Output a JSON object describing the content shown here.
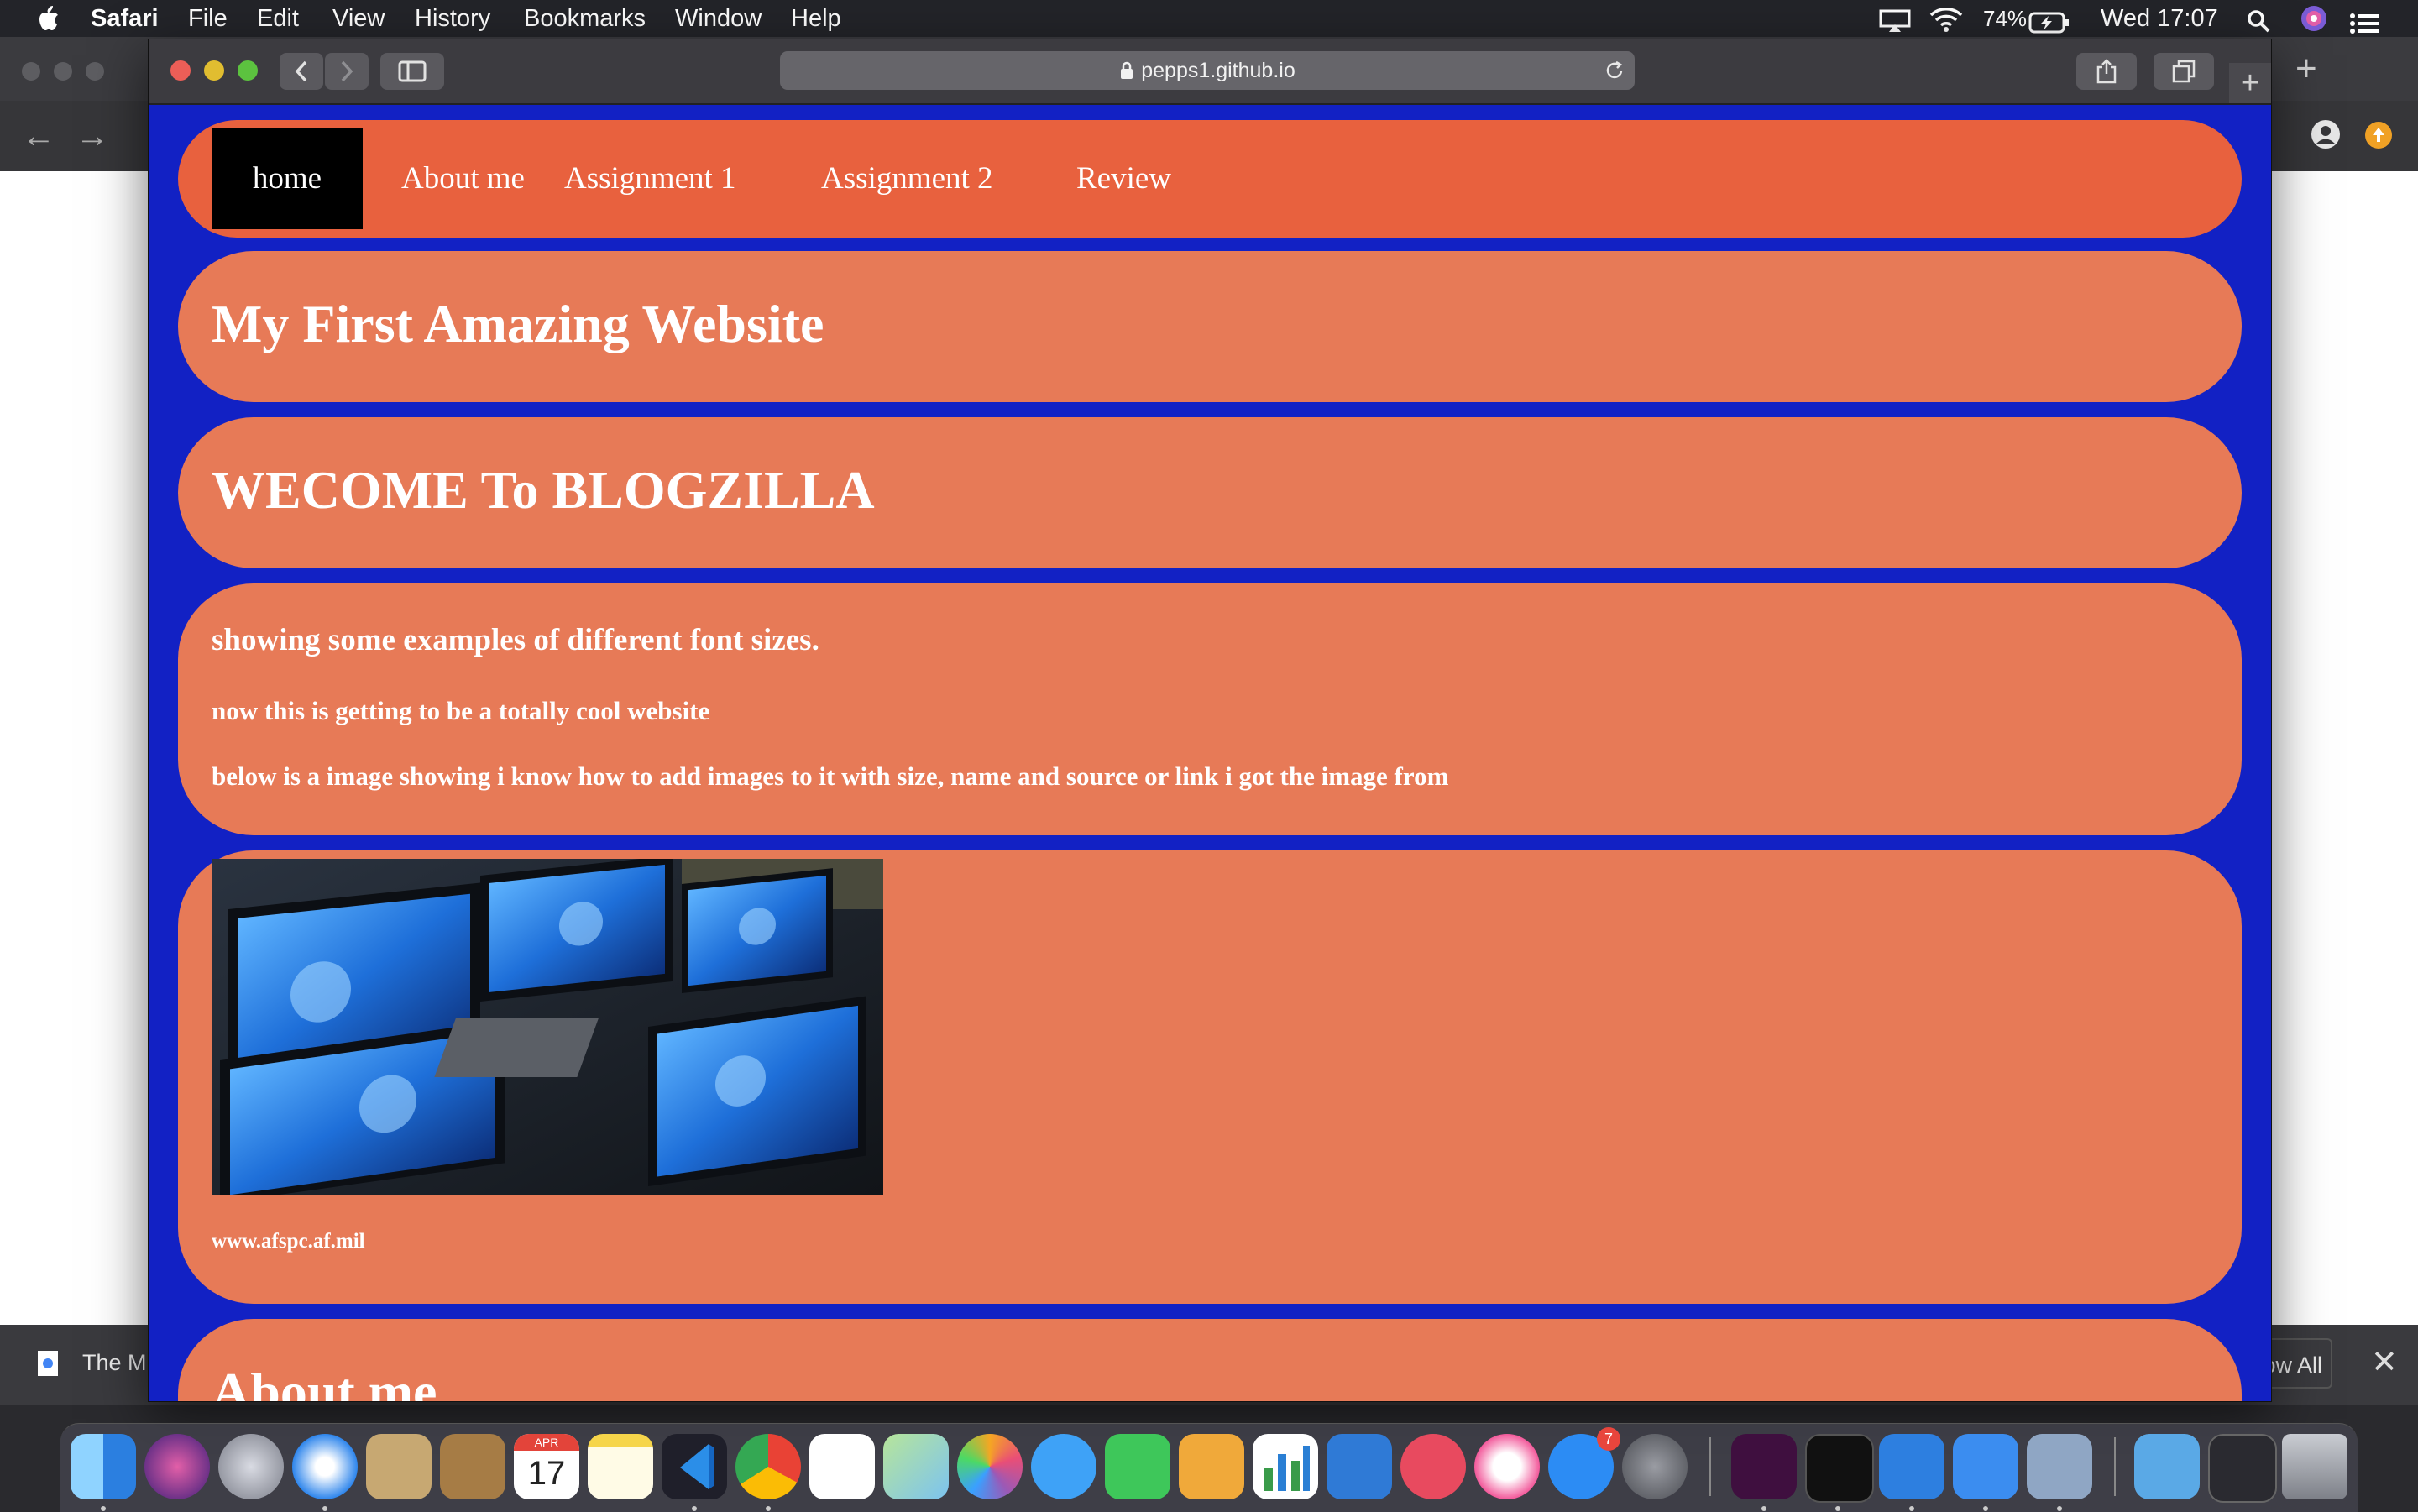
{
  "menubar": {
    "app": "Safari",
    "items": [
      "File",
      "Edit",
      "View",
      "History",
      "Bookmarks",
      "Window",
      "Help"
    ],
    "battery": "74%",
    "clock": "Wed 17:07"
  },
  "browser": {
    "url": "pepps1.github.io"
  },
  "background_window": {
    "download_text": "The M",
    "show_all": "ow All"
  },
  "site": {
    "nav": [
      "home",
      "About me",
      "Assignment 1",
      "Assignment 2",
      "Review"
    ],
    "title": "My First Amazing Website",
    "welcome": "WECOME To BLOGZILLA",
    "font_lines": [
      "showing some examples of different font sizes.",
      "now this is getting to be a totally cool website",
      "below is a image showing i know how to add images to it with size, name and source or link i got the image from"
    ],
    "image_source": "www.afspc.af.mil",
    "about_heading": "About me"
  },
  "dock": {
    "calendar_month": "APR",
    "calendar_day": "17",
    "appstore_badge": "7"
  },
  "colors": {
    "page_bg": "#1221c4",
    "panel": "#e77a57",
    "nav_panel": "#e8613e",
    "active_nav": "#000000"
  }
}
